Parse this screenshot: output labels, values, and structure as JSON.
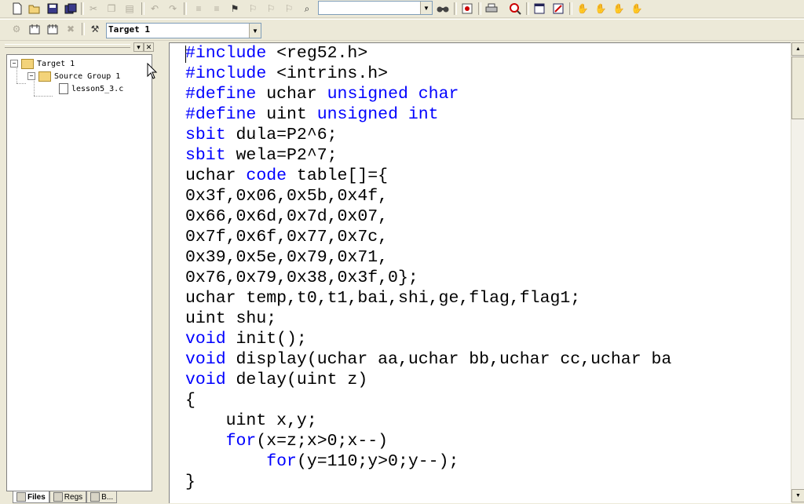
{
  "toolbar1": {
    "icons": [
      "new-file-icon",
      "open-folder-icon",
      "save-icon",
      "save-all-icon",
      "cut-icon",
      "copy-icon",
      "paste-icon",
      "undo-icon",
      "redo-icon",
      "indent-icon",
      "outdent-icon",
      "bookmark-icon",
      "bookmark-next-icon",
      "bookmark-prev-icon",
      "bookmark-clear-icon",
      "find-in-files-icon",
      "find-icon",
      "debug-icon",
      "print-icon",
      "zoom-icon",
      "window-icon",
      "config-icon",
      "hand-icon",
      "break-icon",
      "disable-break-icon",
      "kill-break-icon"
    ],
    "find_value": ""
  },
  "toolbar2": {
    "target_value": "Target 1"
  },
  "project_tree": {
    "root": "Target 1",
    "group": "Source Group 1",
    "file": "lesson5_3.c"
  },
  "tabs": [
    {
      "label": "Files"
    },
    {
      "label": "Regs"
    },
    {
      "label": "B..."
    }
  ],
  "editor": {
    "lines": [
      "#include <reg52.h>",
      "#include <intrins.h>",
      "#define uchar unsigned char",
      "#define uint unsigned int",
      "sbit dula=P2^6;",
      "sbit wela=P2^7;",
      "uchar code table[]={",
      "0x3f,0x06,0x5b,0x4f,",
      "0x66,0x6d,0x7d,0x07,",
      "0x7f,0x6f,0x77,0x7c,",
      "0x39,0x5e,0x79,0x71,",
      "0x76,0x79,0x38,0x3f,0};",
      "uchar temp,t0,t1,bai,shi,ge,flag,flag1;",
      "uint shu;",
      "void init();",
      "void display(uchar aa,uchar bb,uchar cc,uchar ba",
      "void delay(uint z)",
      "{",
      "    uint x,y;",
      "    for(x=z;x>0;x--)",
      "        for(y=110;y>0;y--);",
      "}"
    ]
  },
  "colors": {
    "keyword": "#0000ff",
    "text": "#000000",
    "chrome": "#ece9d8"
  }
}
